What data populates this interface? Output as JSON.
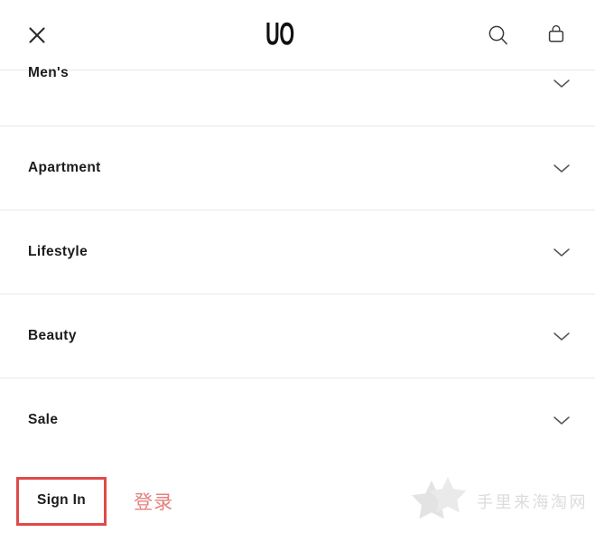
{
  "header": {
    "close_icon": "close-icon",
    "logo_text": "UO",
    "search_icon": "search-icon",
    "bag_icon": "shopping-bag-icon"
  },
  "menu": {
    "chevron_icon": "chevron-down-icon",
    "items": [
      {
        "label": "Men's",
        "clipped": true
      },
      {
        "label": "Apartment",
        "clipped": false
      },
      {
        "label": "Lifestyle",
        "clipped": false
      },
      {
        "label": "Beauty",
        "clipped": false
      },
      {
        "label": "Sale",
        "clipped": false
      }
    ]
  },
  "account": {
    "signin_label": "Sign In",
    "signin_label_cn": "登录",
    "highlight_color": "#e04a4a",
    "annotation_color": "#e4807f"
  },
  "watermark": {
    "text": "手里来海淘网",
    "color": "#dcdcdc"
  }
}
